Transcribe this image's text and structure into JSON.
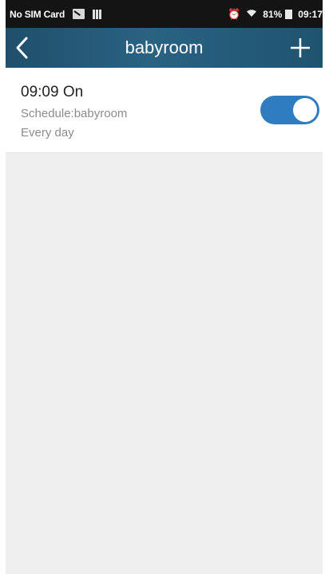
{
  "status_bar": {
    "carrier": "No SIM Card",
    "battery_percent": "81%",
    "time": "09:17",
    "icons": [
      "sim-disabled-icon",
      "signal-bars-icon",
      "alarm-icon",
      "wifi-icon",
      "battery-icon"
    ]
  },
  "nav": {
    "title": "babyroom",
    "back_icon": "chevron-left-icon",
    "add_icon": "plus-icon"
  },
  "schedules": [
    {
      "time_action": "09:09 On",
      "schedule_label": "Schedule:babyroom",
      "repeat": "Every day",
      "enabled": true
    }
  ],
  "colors": {
    "nav_gradient_start": "#1f4f6b",
    "nav_gradient_mid": "#2a6282",
    "toggle_on": "#2f7dc0",
    "background": "#efefef",
    "status_bar": "#141414"
  }
}
